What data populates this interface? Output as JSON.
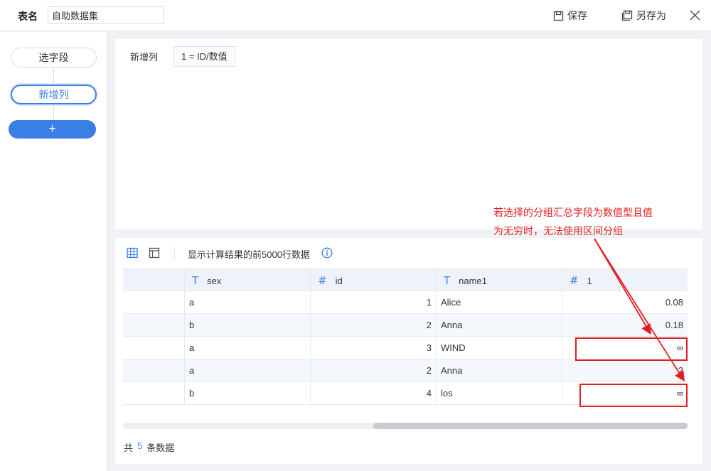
{
  "header": {
    "table_label": "表名",
    "table_name_value": "自助数据集",
    "save_label": "保存",
    "save_as_label": "另存为"
  },
  "sidebar": {
    "steps": [
      {
        "label": "选字段"
      },
      {
        "label": "新增列"
      }
    ],
    "add_label": "+"
  },
  "config": {
    "label": "新增列",
    "formula": "1 = ID/数值"
  },
  "preview": {
    "note": "显示计算结果的前5000行数据",
    "columns": [
      {
        "type_icon": "T",
        "name": "sex"
      },
      {
        "type_icon": "#",
        "name": "id"
      },
      {
        "type_icon": "T",
        "name": "name1"
      },
      {
        "type_icon": "#",
        "name": "1"
      }
    ],
    "rows": [
      [
        "a",
        "1",
        "Alice",
        "0.08"
      ],
      [
        "b",
        "2",
        "Anna",
        "0.18"
      ],
      [
        "a",
        "3",
        "WIND",
        "∞"
      ],
      [
        "a",
        "2",
        "Anna",
        "2"
      ],
      [
        "b",
        "4",
        "los",
        "∞"
      ]
    ],
    "total_prefix": "共",
    "total_count": "5",
    "total_suffix": "条数据"
  },
  "annotation": {
    "line1": "若选择的分组汇总字段为数值型且值",
    "line2": "为无穷时，无法使用区间分组",
    "color": "#e02020"
  },
  "colors": {
    "accent": "#3a7ee6"
  }
}
